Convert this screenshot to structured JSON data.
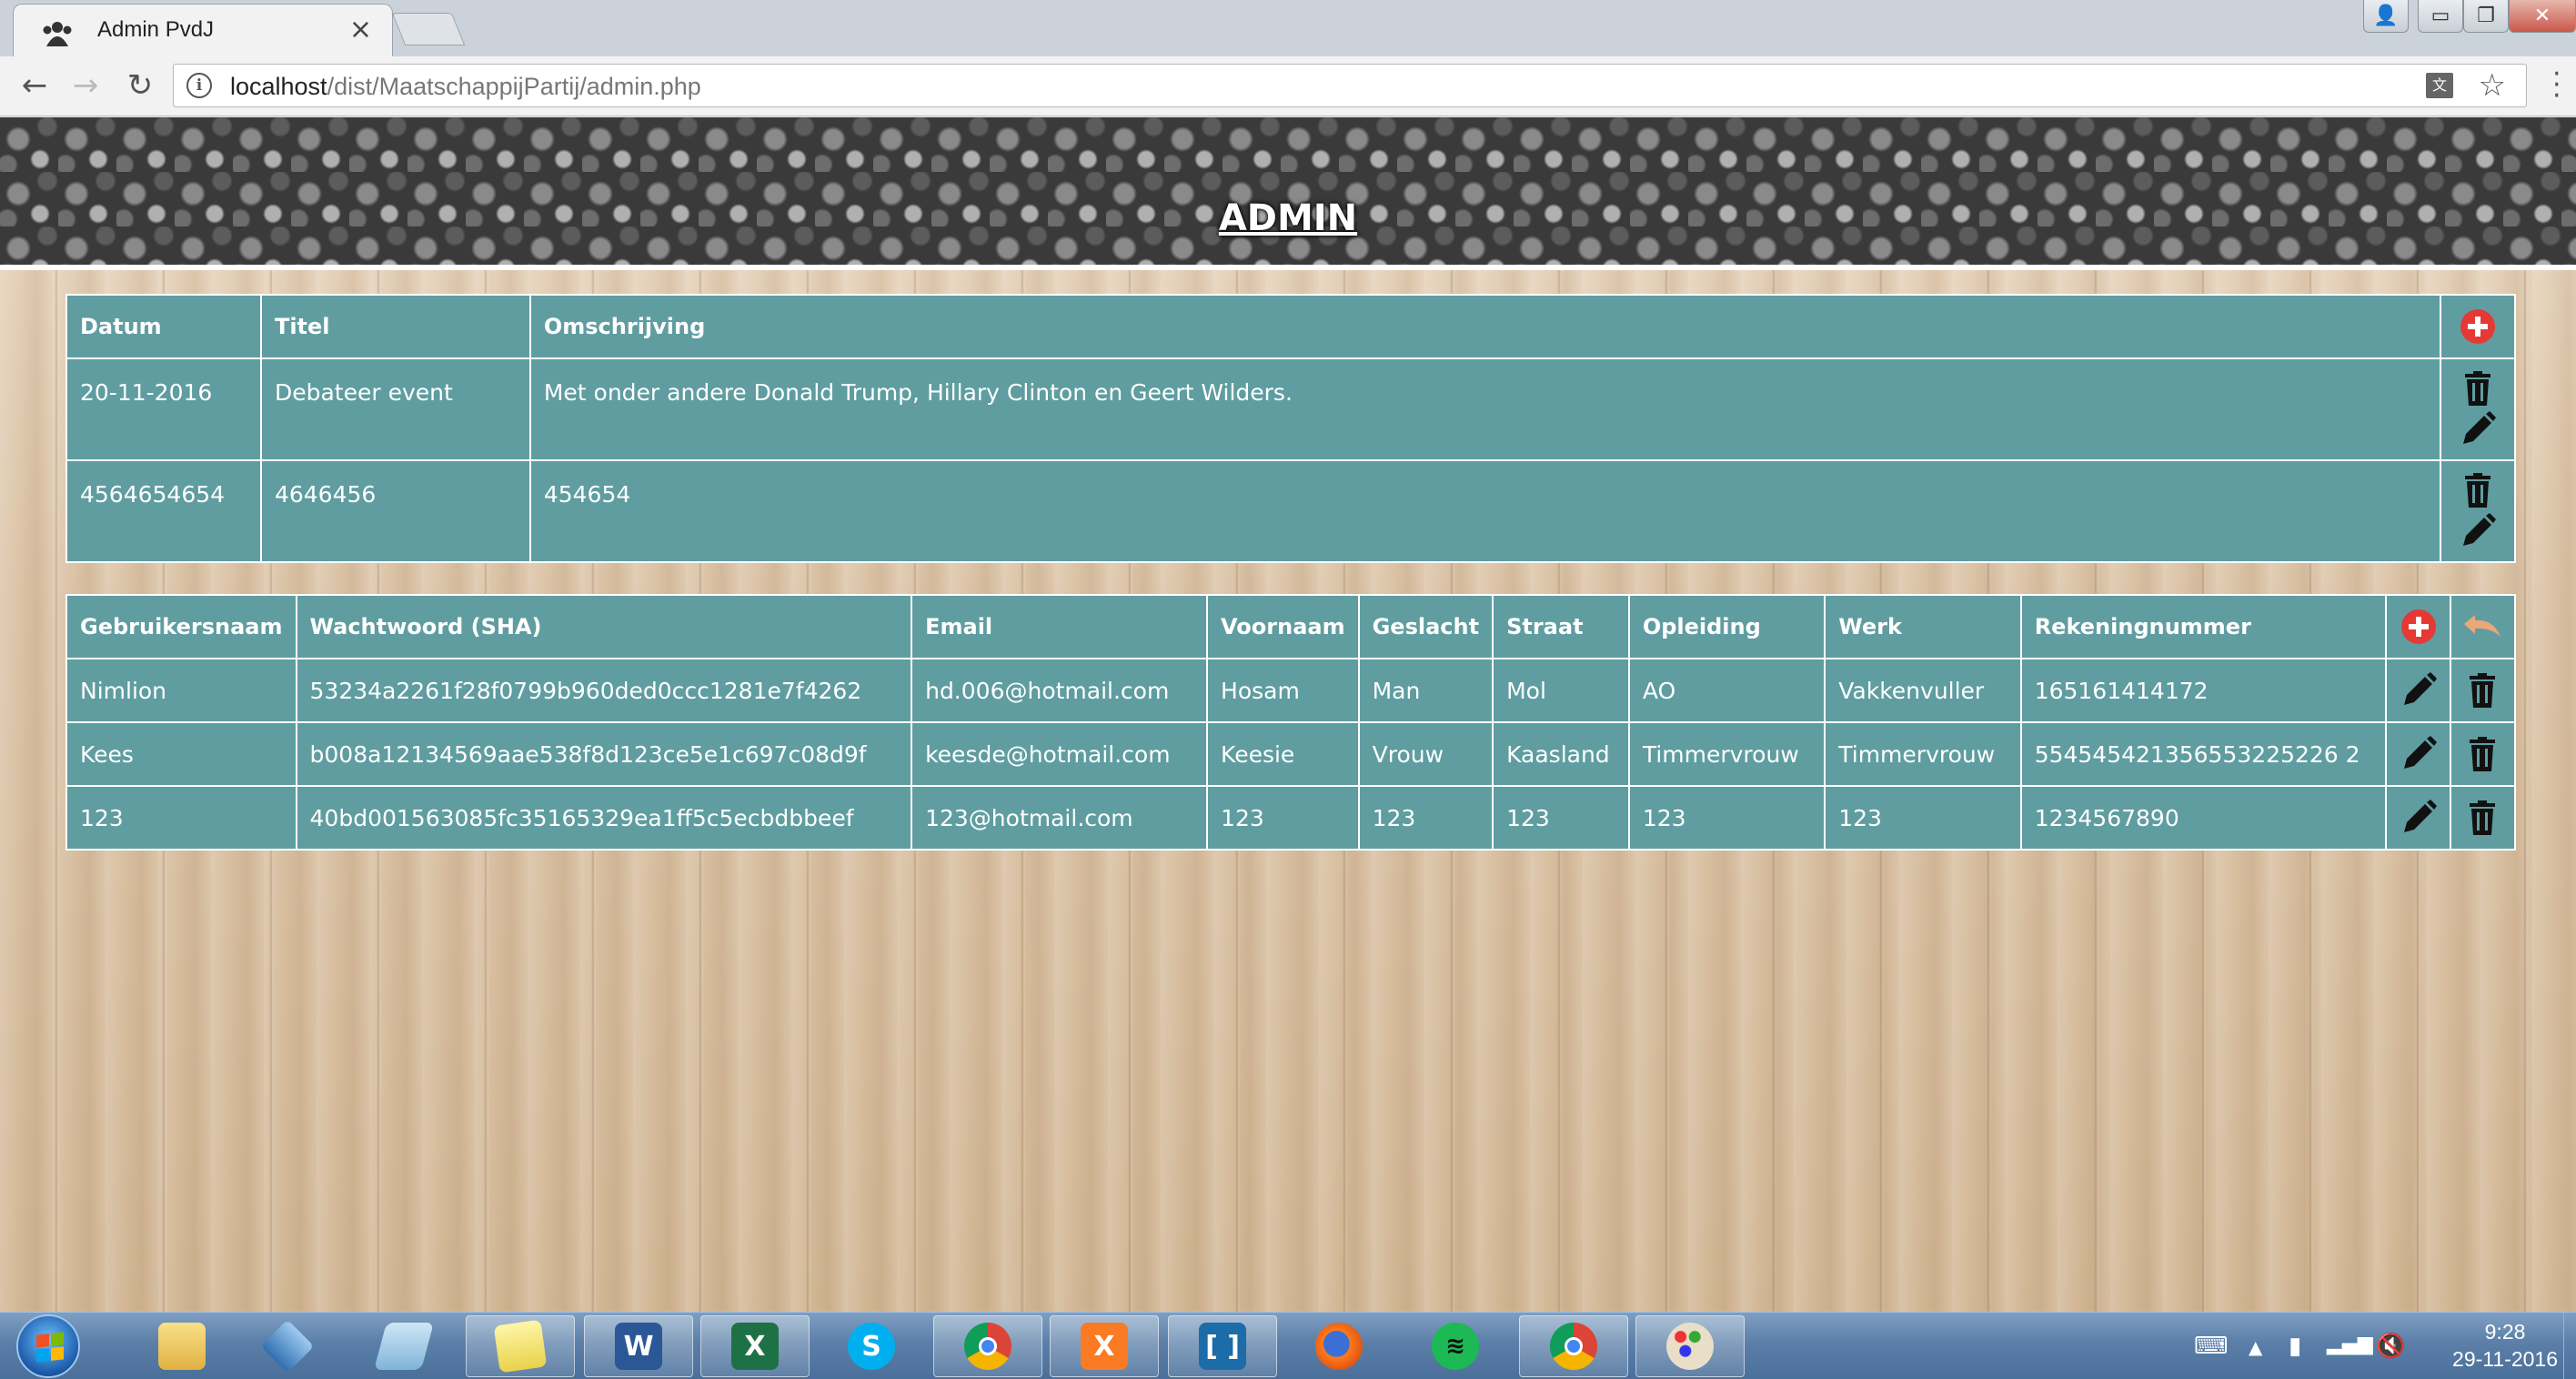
{
  "browser": {
    "tab_title": "Admin PvdJ",
    "tab_close": "×",
    "url_host": "localhost",
    "url_path": "/dist/MaatschappijPartij/admin.php",
    "win_user": "👤",
    "win_min": "▭",
    "win_restore": "❐",
    "win_close": "✕"
  },
  "page": {
    "title": "ADMIN"
  },
  "events": {
    "columns": [
      "Datum",
      "Titel",
      "Omschrijving"
    ],
    "rows": [
      {
        "datum": "20-11-2016",
        "titel": "Debateer event",
        "omschrijving": "Met onder andere Donald Trump, Hillary Clinton en Geert Wilders."
      },
      {
        "datum": "4564654654",
        "titel": "4646456",
        "omschrijving": "454654"
      }
    ]
  },
  "users": {
    "columns": [
      "Gebruikersnaam",
      "Wachtwoord (SHA)",
      "Email",
      "Voornaam",
      "Geslacht",
      "Straat",
      "Opleiding",
      "Werk",
      "Rekeningnummer"
    ],
    "rows": [
      {
        "gebruikersnaam": "Nimlion",
        "wachtwoord": "53234a2261f28f0799b960ded0ccc1281e7f4262",
        "email": "hd.006@hotmail.com",
        "voornaam": "Hosam",
        "geslacht": "Man",
        "straat": "Mol",
        "opleiding": "AO",
        "werk": "Vakkenvuller",
        "rekeningnummer": "165161414172"
      },
      {
        "gebruikersnaam": "Kees",
        "wachtwoord": "b008a12134569aae538f8d123ce5e1c697c08d9f",
        "email": "keesde@hotmail.com",
        "voornaam": "Keesie",
        "geslacht": "Vrouw",
        "straat": "Kaasland",
        "opleiding": "Timmervrouw",
        "werk": "Timmervrouw",
        "rekeningnummer": "554545421356553225226 2"
      },
      {
        "gebruikersnaam": "123",
        "wachtwoord": "40bd001563085fc35165329ea1ff5c5ecbdbbeef",
        "email": "123@hotmail.com",
        "voornaam": "123",
        "geslacht": "123",
        "straat": "123",
        "opleiding": "123",
        "werk": "123",
        "rekeningnummer": "1234567890"
      }
    ]
  },
  "icons": {
    "add": "plus-circle-icon",
    "delete": "trash-icon",
    "edit": "pencil-icon",
    "undo": "undo-arrow-icon"
  },
  "colors": {
    "table_bg": "#5f9da0",
    "add_button": "#e53935",
    "undo_icon": "#e8a878"
  },
  "taskbar": {
    "time": "9:28",
    "date": "29-11-2016"
  }
}
